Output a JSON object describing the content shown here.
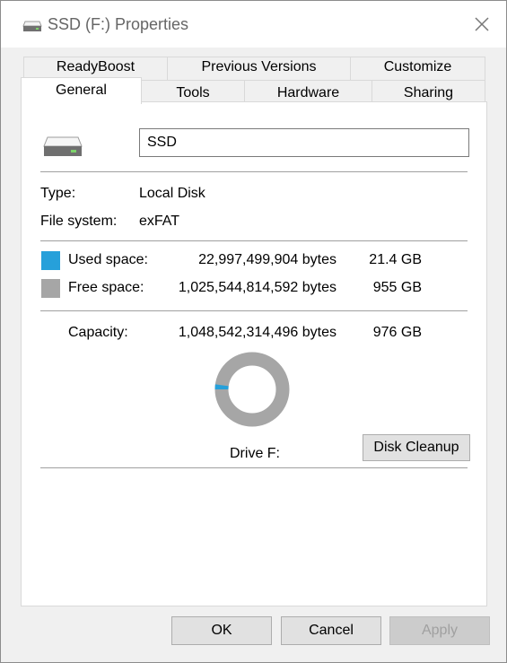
{
  "window": {
    "title": "SSD (F:) Properties"
  },
  "tabs": {
    "readyboost": "ReadyBoost",
    "previous_versions": "Previous Versions",
    "customize": "Customize",
    "general": "General",
    "tools": "Tools",
    "hardware": "Hardware",
    "sharing": "Sharing"
  },
  "general": {
    "drive_name": "SSD",
    "type_label": "Type:",
    "type_value": "Local Disk",
    "fs_label": "File system:",
    "fs_value": "exFAT",
    "used_label": "Used space:",
    "used_bytes": "22,997,499,904 bytes",
    "used_gb": "21.4 GB",
    "free_label": "Free space:",
    "free_bytes": "1,025,544,814,592 bytes",
    "free_gb": "955 GB",
    "capacity_label": "Capacity:",
    "capacity_bytes": "1,048,542,314,496 bytes",
    "capacity_gb": "976 GB",
    "drive_label": "Drive F:",
    "disk_cleanup": "Disk Cleanup",
    "used_fraction": 0.0219
  },
  "colors": {
    "used": "#26a0da",
    "free": "#a6a6a6"
  },
  "buttons": {
    "ok": "OK",
    "cancel": "Cancel",
    "apply": "Apply"
  }
}
